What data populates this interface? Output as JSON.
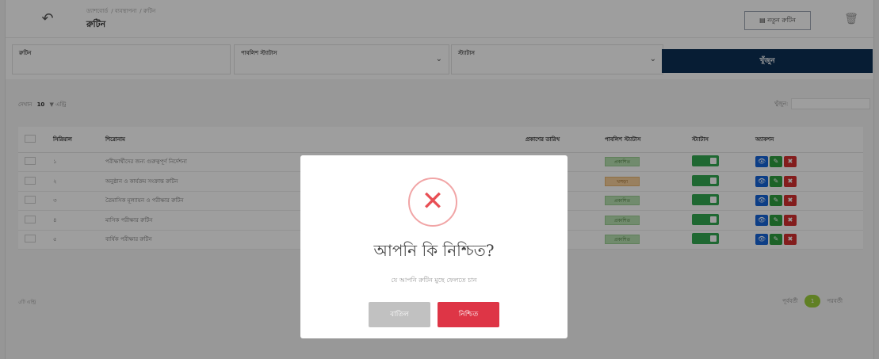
{
  "header": {
    "back_icon": "back-arrow-icon",
    "breadcrumb": [
      "ড্যাশবোর্ড",
      "ব্যবস্থাপনা",
      "রুটিন"
    ],
    "title": "রুটিন",
    "new_button": "নতুন রুটিন",
    "trash_icon": "trash-icon"
  },
  "filters": {
    "field1": {
      "label": "রুটিন",
      "value": ""
    },
    "field2": {
      "label": "পাবলিশ স্ট্যাটাস",
      "value": ""
    },
    "field3": {
      "label": "স্ট্যাটাস",
      "value": ""
    },
    "search_button": "খুঁজুন"
  },
  "table": {
    "length_prefix": "দেখান",
    "length_value": "10",
    "length_suffix": "এন্ট্রি",
    "search_label": "খুঁজুন:",
    "columns": [
      "",
      "সিরিয়াল",
      "শিরোনাম",
      "প্রকাশের তারিখ",
      "পাবলিশ স্ট্যাটাস",
      "স্ট্যাটাস",
      "অ্যাকশন"
    ],
    "rows": [
      {
        "serial": "১",
        "title": "পরীক্ষার্থীদের জন্য গুরুত্বপূর্ণ নির্দেশনা",
        "date": "",
        "status": "প্রকাশিত",
        "warn": false
      },
      {
        "serial": "২",
        "title": "অনুষ্ঠান ও কার্যক্রম সংক্রান্ত রুটিন",
        "date": "",
        "status": "খসড়া",
        "warn": true
      },
      {
        "serial": "৩",
        "title": "ত্রৈমাসিক মূল্যায়ন ও পরীক্ষার রুটিন",
        "date": "",
        "status": "প্রকাশিত",
        "warn": false
      },
      {
        "serial": "৪",
        "title": "মাসিক পরীক্ষার রুটিন",
        "date": "",
        "status": "প্রকাশিত",
        "warn": false
      },
      {
        "serial": "৫",
        "title": "বার্ষিক পরীক্ষার রুটিন",
        "date": "",
        "status": "প্রকাশিত",
        "warn": false
      }
    ],
    "info": "৫টি এন্ট্রি",
    "pager_prev": "পূর্ববর্তী",
    "pager_page": "1",
    "pager_next": "পরবর্তী"
  },
  "modal": {
    "icon": "error-x-icon",
    "title": "আপনি কি নিশ্চিত?",
    "text": "যে আপনি রুটিন মুছে ফেলতে চান",
    "cancel": "বাতিল",
    "confirm": "নিশ্চিত"
  },
  "colors": {
    "primary": "#0c2f54",
    "danger": "#de3546",
    "success": "#32a852",
    "info": "#1565d8"
  }
}
